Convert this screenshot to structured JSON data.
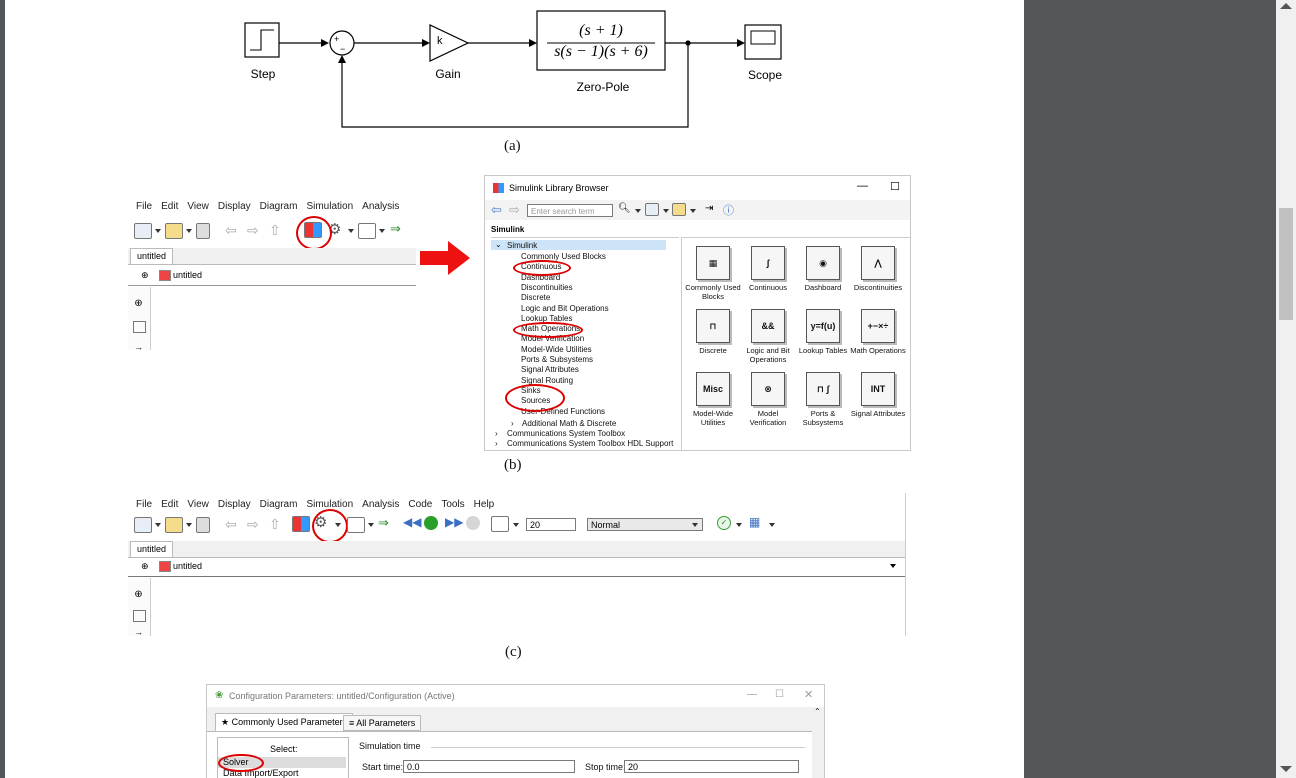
{
  "figure": {
    "caption_a": "(a)",
    "caption_b": "(b)",
    "caption_c": "(c)"
  },
  "diagram": {
    "blocks": {
      "step": "Step",
      "gain": "Gain",
      "gain_symbol": "k",
      "zeropole": "Zero-Pole",
      "zeropole_num": "(s + 1)",
      "zeropole_den": "s(s − 1)(s + 6)",
      "scope": "Scope",
      "sum_plus": "+",
      "sum_minus": "−"
    }
  },
  "editor_b": {
    "menu": [
      "File",
      "Edit",
      "View",
      "Display",
      "Diagram",
      "Simulation",
      "Analysis"
    ],
    "tab": "untitled",
    "address": "untitled"
  },
  "library_browser": {
    "title": "Simulink Library Browser",
    "search_placeholder": "Enter search term",
    "heading": "Simulink",
    "tree_root": "Simulink",
    "tree_items": [
      "Commonly Used Blocks",
      "Continuous",
      "Dashboard",
      "Discontinuities",
      "Discrete",
      "Logic and Bit Operations",
      "Lookup Tables",
      "Math Operations",
      "Model Verification",
      "Model-Wide Utilities",
      "Ports & Subsystems",
      "Signal Attributes",
      "Signal Routing",
      "Sinks",
      "Sources",
      "User-Defined Functions"
    ],
    "tree_sub": [
      "Additional Math & Discrete",
      "Communications System Toolbox",
      "Communications System Toolbox HDL Support"
    ],
    "tiles": [
      {
        "label": "Commonly Used Blocks",
        "glyph": "▦"
      },
      {
        "label": "Continuous",
        "glyph": "∫"
      },
      {
        "label": "Dashboard",
        "glyph": "◉"
      },
      {
        "label": "Discontinuities",
        "glyph": "⋀"
      },
      {
        "label": "Discrete",
        "glyph": "⊓"
      },
      {
        "label": "Logic and Bit Operations",
        "glyph": "&&"
      },
      {
        "label": "Lookup Tables",
        "glyph": "y=f(u)"
      },
      {
        "label": "Math Operations",
        "glyph": "+−×÷"
      },
      {
        "label": "Model-Wide Utilities",
        "glyph": "Misc"
      },
      {
        "label": "Model Verification",
        "glyph": "⊗"
      },
      {
        "label": "Ports & Subsystems",
        "glyph": "⊓ ∫"
      },
      {
        "label": "Signal Attributes",
        "glyph": "INT"
      }
    ]
  },
  "editor_c": {
    "menu": [
      "File",
      "Edit",
      "View",
      "Display",
      "Diagram",
      "Simulation",
      "Analysis",
      "Code",
      "Tools",
      "Help"
    ],
    "stop_time": "20",
    "mode": "Normal",
    "tab": "untitled",
    "address": "untitled"
  },
  "config": {
    "title": "Configuration Parameters: untitled/Configuration (Active)",
    "tab_common": "★ Commonly Used Parameters",
    "tab_all": "≡ All Parameters",
    "select_label": "Select:",
    "list": [
      "Solver",
      "Data Import/Export"
    ],
    "section": "Simulation time",
    "start_label": "Start time:",
    "start_value": "0.0",
    "stop_label": "Stop time:",
    "stop_value": "20"
  }
}
